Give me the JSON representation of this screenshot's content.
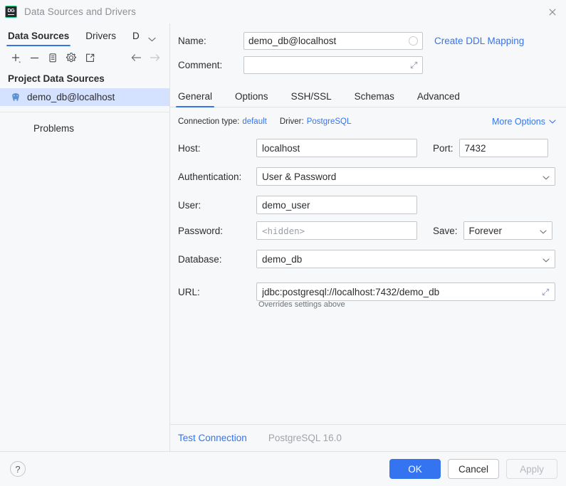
{
  "window": {
    "title": "Data Sources and Drivers",
    "logo_text": "DG",
    "close_label": "close-icon"
  },
  "sidebar": {
    "tabs": [
      {
        "label": "Data Sources",
        "active": true
      },
      {
        "label": "Drivers",
        "active": false
      },
      {
        "label": "D",
        "active": false
      }
    ],
    "toolbar": [
      {
        "name": "add-icon",
        "tooltip": "Add"
      },
      {
        "name": "remove-icon",
        "tooltip": "Remove"
      },
      {
        "name": "duplicate-icon",
        "tooltip": "Duplicate"
      },
      {
        "name": "settings-gear-icon",
        "tooltip": "Settings"
      },
      {
        "name": "share-export-icon",
        "tooltip": "Export"
      },
      {
        "name": "back-arrow-icon",
        "tooltip": "Back"
      },
      {
        "name": "forward-arrow-icon",
        "tooltip": "Forward"
      }
    ],
    "section_title": "Project Data Sources",
    "items": [
      {
        "label": "demo_db@localhost",
        "icon": "postgresql-icon",
        "selected": true
      }
    ],
    "problems_label": "Problems"
  },
  "form": {
    "name_label": "Name:",
    "name_value": "demo_db@localhost",
    "comment_label": "Comment:",
    "comment_value": "",
    "create_ddl_mapping": "Create DDL Mapping"
  },
  "tabs": [
    {
      "label": "General",
      "active": true
    },
    {
      "label": "Options",
      "active": false
    },
    {
      "label": "SSH/SSL",
      "active": false
    },
    {
      "label": "Schemas",
      "active": false
    },
    {
      "label": "Advanced",
      "active": false
    }
  ],
  "general": {
    "connection_type_label": "Connection type:",
    "connection_type_value": "default",
    "driver_label": "Driver:",
    "driver_value": "PostgreSQL",
    "more_options": "More Options",
    "host_label": "Host:",
    "host_value": "localhost",
    "port_label": "Port:",
    "port_value": "7432",
    "authentication_label": "Authentication:",
    "authentication_value": "User & Password",
    "user_label": "User:",
    "user_value": "demo_user",
    "password_label": "Password:",
    "password_placeholder": "<hidden>",
    "save_label": "Save:",
    "save_value": "Forever",
    "database_label": "Database:",
    "database_value": "demo_db",
    "url_label": "URL:",
    "url_value": "jdbc:postgresql://localhost:7432/demo_db",
    "url_hint": "Overrides settings above"
  },
  "bottom": {
    "test_connection": "Test Connection",
    "server_version": "PostgreSQL 16.0",
    "help": "?",
    "ok": "OK",
    "cancel": "Cancel",
    "apply": "Apply"
  },
  "colors": {
    "accent": "#3574f0",
    "selection": "#d4e2ff",
    "background": "#f7f8fa",
    "border": "#c4c6cb",
    "muted_text": "#a0a3a8",
    "logo_green": "#21d789"
  }
}
